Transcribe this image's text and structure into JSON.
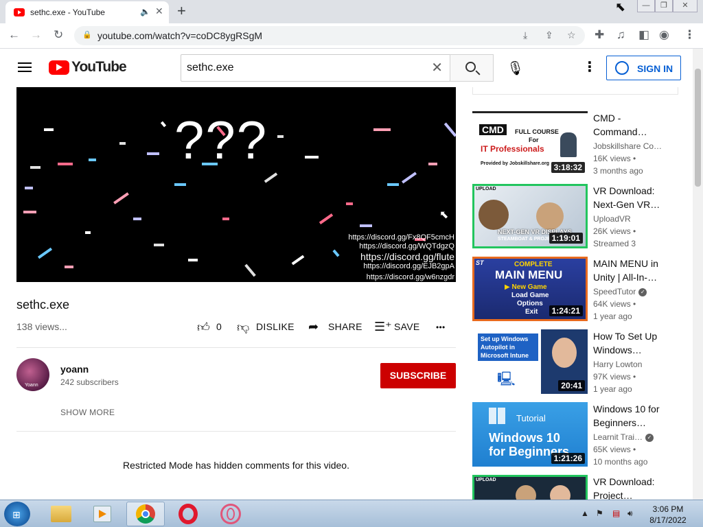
{
  "browser": {
    "tab_title": "sethc.exe - YouTube",
    "url": "youtube.com/watch?v=coDC8ygRSgM",
    "window_buttons": [
      "—",
      "❐",
      "✕"
    ]
  },
  "yt_header": {
    "logo_text": "YouTube",
    "search_query": "sethc.exe",
    "sign_in_label": "SIGN IN"
  },
  "player": {
    "overlay_text": "???",
    "discord_links": [
      "https://discord.gg/Fx8QF5cmcH",
      "https://discord.gg/WQTdgzQ",
      "https://discord.gg/flute",
      "https://discord.gg/EJB2gpA",
      "https://discord.gg/w6nzgdr"
    ]
  },
  "video": {
    "title": "sethc.exe",
    "views": "138 views...",
    "like_count": "0",
    "dislike_label": "DISLIKE",
    "share_label": "SHARE",
    "save_label": "SAVE",
    "more_label": "•••"
  },
  "channel": {
    "name": "yoann",
    "subscribers": "242 subscribers",
    "avatar_label": "Yoann",
    "subscribe_label": "SUBSCRIBE",
    "show_more_label": "SHOW MORE"
  },
  "comments": {
    "restricted_text": "Restricted Mode has hidden comments for this video."
  },
  "recommendations": [
    {
      "title1": "CMD -",
      "title2": "Command…",
      "channel": "Jobskillshare Co…",
      "views": "16K views •",
      "age": "3 months ago",
      "duration": "3:18:32",
      "thumb_lines": [
        "CMD",
        "FULL COURSE",
        "For",
        "IT Professionals",
        "Provided by Jobskillshare.org"
      ],
      "verified": false
    },
    {
      "title1": "VR Download:",
      "title2": "Next-Gen VR…",
      "channel": "UploadVR",
      "views": "26K views •",
      "age": "Streamed 3",
      "duration": "1:19:01",
      "thumb_lines": [
        "UPLOAD",
        "NEXT-GEN VR DISPLAYS",
        "STEAMBOAT & PROJECT"
      ],
      "verified": false
    },
    {
      "title1": "MAIN MENU in",
      "title2": "Unity | All-In-…",
      "channel": "SpeedTutor",
      "views": "64K views •",
      "age": "1 year ago",
      "duration": "1:24:21",
      "thumb_lines": [
        "COMPLETE",
        "MAIN MENU",
        "▶ New Game",
        "Load Game",
        "Options",
        "Exit",
        "ST"
      ],
      "verified": true
    },
    {
      "title1": "How To Set Up",
      "title2": "Windows…",
      "channel": "Harry Lowton",
      "views": "97K views •",
      "age": "1 year ago",
      "duration": "20:41",
      "thumb_lines": [
        "Set up Windows",
        "Autopilot in",
        "Microsoft Intune"
      ],
      "verified": false
    },
    {
      "title1": "Windows 10 for",
      "title2": "Beginners…",
      "channel": "Learnit Trai…",
      "views": "65K views •",
      "age": "10 months ago",
      "duration": "1:21:26",
      "thumb_lines": [
        "Tutorial",
        "Windows 10",
        "for Beginners"
      ],
      "verified": true
    },
    {
      "title1": "VR Download:",
      "title2": "Project…",
      "channel": "",
      "views": "",
      "age": "",
      "duration": "",
      "thumb_lines": [
        "UPLOAD"
      ],
      "verified": false
    }
  ],
  "taskbar": {
    "time": "3:06 PM",
    "date": "8/17/2022"
  },
  "colors": {
    "yt_red": "#ff0000",
    "subscribe_red": "#cc0000",
    "link_blue": "#065fd4"
  }
}
